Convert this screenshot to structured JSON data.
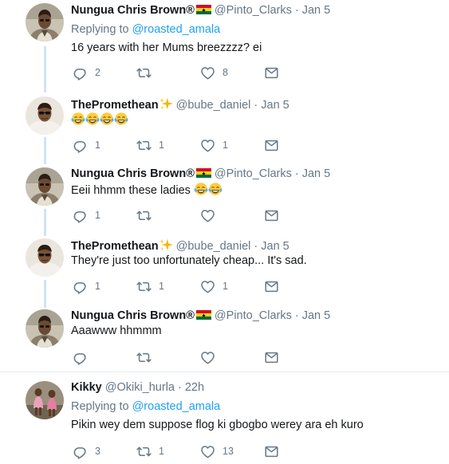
{
  "colors": {
    "link": "#1da1f2",
    "muted": "#657786",
    "text": "#14171a",
    "thread_line": "#cfe3f5"
  },
  "tweets": [
    {
      "name": "Nungua Chris Brown",
      "mark": "®",
      "flag": "ghana-flag",
      "handle": "@Pinto_Clarks",
      "time": "· Jan 5",
      "reply_prefix": "Replying to",
      "reply_to": "@roasted_amala",
      "text": "16 years with her Mums breezzzz? ei",
      "replies": "2",
      "retweets": "",
      "likes": "8"
    },
    {
      "name": "ThePromethean",
      "badge": "sparkles-emoji",
      "handle": "@bube_daniel",
      "time": "· Jan 5",
      "text": "",
      "text_emoji": [
        "tears-of-joy-emoji",
        "tears-of-joy-emoji",
        "tears-of-joy-emoji",
        "tears-of-joy-emoji"
      ],
      "replies": "1",
      "retweets": "1",
      "likes": "1"
    },
    {
      "name": "Nungua Chris Brown",
      "mark": "®",
      "flag": "ghana-flag",
      "handle": "@Pinto_Clarks",
      "time": "· Jan 5",
      "text": "Eeii hhmm these ladies",
      "text_emoji": [
        "tears-of-joy-emoji",
        "tears-of-joy-emoji"
      ],
      "replies": "1",
      "retweets": "",
      "likes": ""
    },
    {
      "name": "ThePromethean",
      "badge": "sparkles-emoji",
      "handle": "@bube_daniel",
      "time": "· Jan 5",
      "text": "They're just too unfortunately cheap... It's sad.",
      "replies": "1",
      "retweets": "1",
      "likes": "1"
    },
    {
      "name": "Nungua Chris Brown",
      "mark": "®",
      "flag": "ghana-flag",
      "handle": "@Pinto_Clarks",
      "time": "· Jan 5",
      "text": "Aaawww hhmmm",
      "replies": "",
      "retweets": "",
      "likes": ""
    },
    {
      "name": "Kikky",
      "handle": "@Okiki_hurla",
      "time": "· 22h",
      "reply_prefix": "Replying to",
      "reply_to": "@roasted_amala",
      "text": "Pikin wey dem suppose flog ki gbogbo werey ara eh kuro",
      "replies": "3",
      "retweets": "1",
      "likes": "13"
    }
  ]
}
